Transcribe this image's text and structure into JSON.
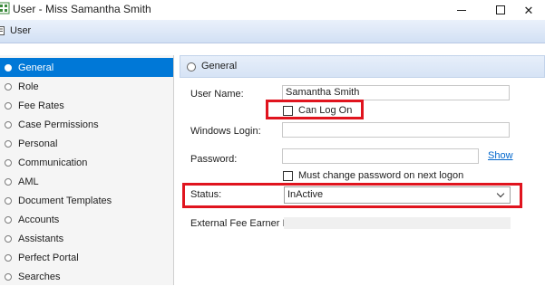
{
  "window": {
    "title": "User - Miss Samantha Smith",
    "close_glyph": "✕"
  },
  "header": {
    "label": "User"
  },
  "sidebar": {
    "items": [
      {
        "label": "General",
        "selected": true
      },
      {
        "label": "Role"
      },
      {
        "label": "Fee Rates"
      },
      {
        "label": "Case Permissions"
      },
      {
        "label": "Personal"
      },
      {
        "label": "Communication"
      },
      {
        "label": "AML"
      },
      {
        "label": "Document Templates"
      },
      {
        "label": "Accounts"
      },
      {
        "label": "Assistants"
      },
      {
        "label": "Perfect Portal"
      },
      {
        "label": "Searches"
      }
    ]
  },
  "section": {
    "title": "General"
  },
  "form": {
    "user_name": {
      "label": "User Name:",
      "value": "Samantha Smith"
    },
    "can_log_on": {
      "label": "Can Log On",
      "checked": false
    },
    "windows_login": {
      "label": "Windows Login:",
      "value": ""
    },
    "password": {
      "label": "Password:",
      "value": "",
      "show_label": "Show"
    },
    "must_change_password": {
      "label": "Must change password on next logon",
      "checked": false
    },
    "status": {
      "label": "Status:",
      "value": "InActive"
    },
    "external_fee_earner_id": {
      "label": "External Fee Earner ID:",
      "value": ""
    }
  },
  "colors": {
    "selection": "#0078d7",
    "highlight": "#e0141e",
    "link": "#0066cc",
    "header_band": "#d2e0f4"
  },
  "icons": [
    "app-icon",
    "minimize-icon",
    "maximize-icon",
    "close-icon",
    "radio-icon",
    "chevron-down-icon"
  ]
}
